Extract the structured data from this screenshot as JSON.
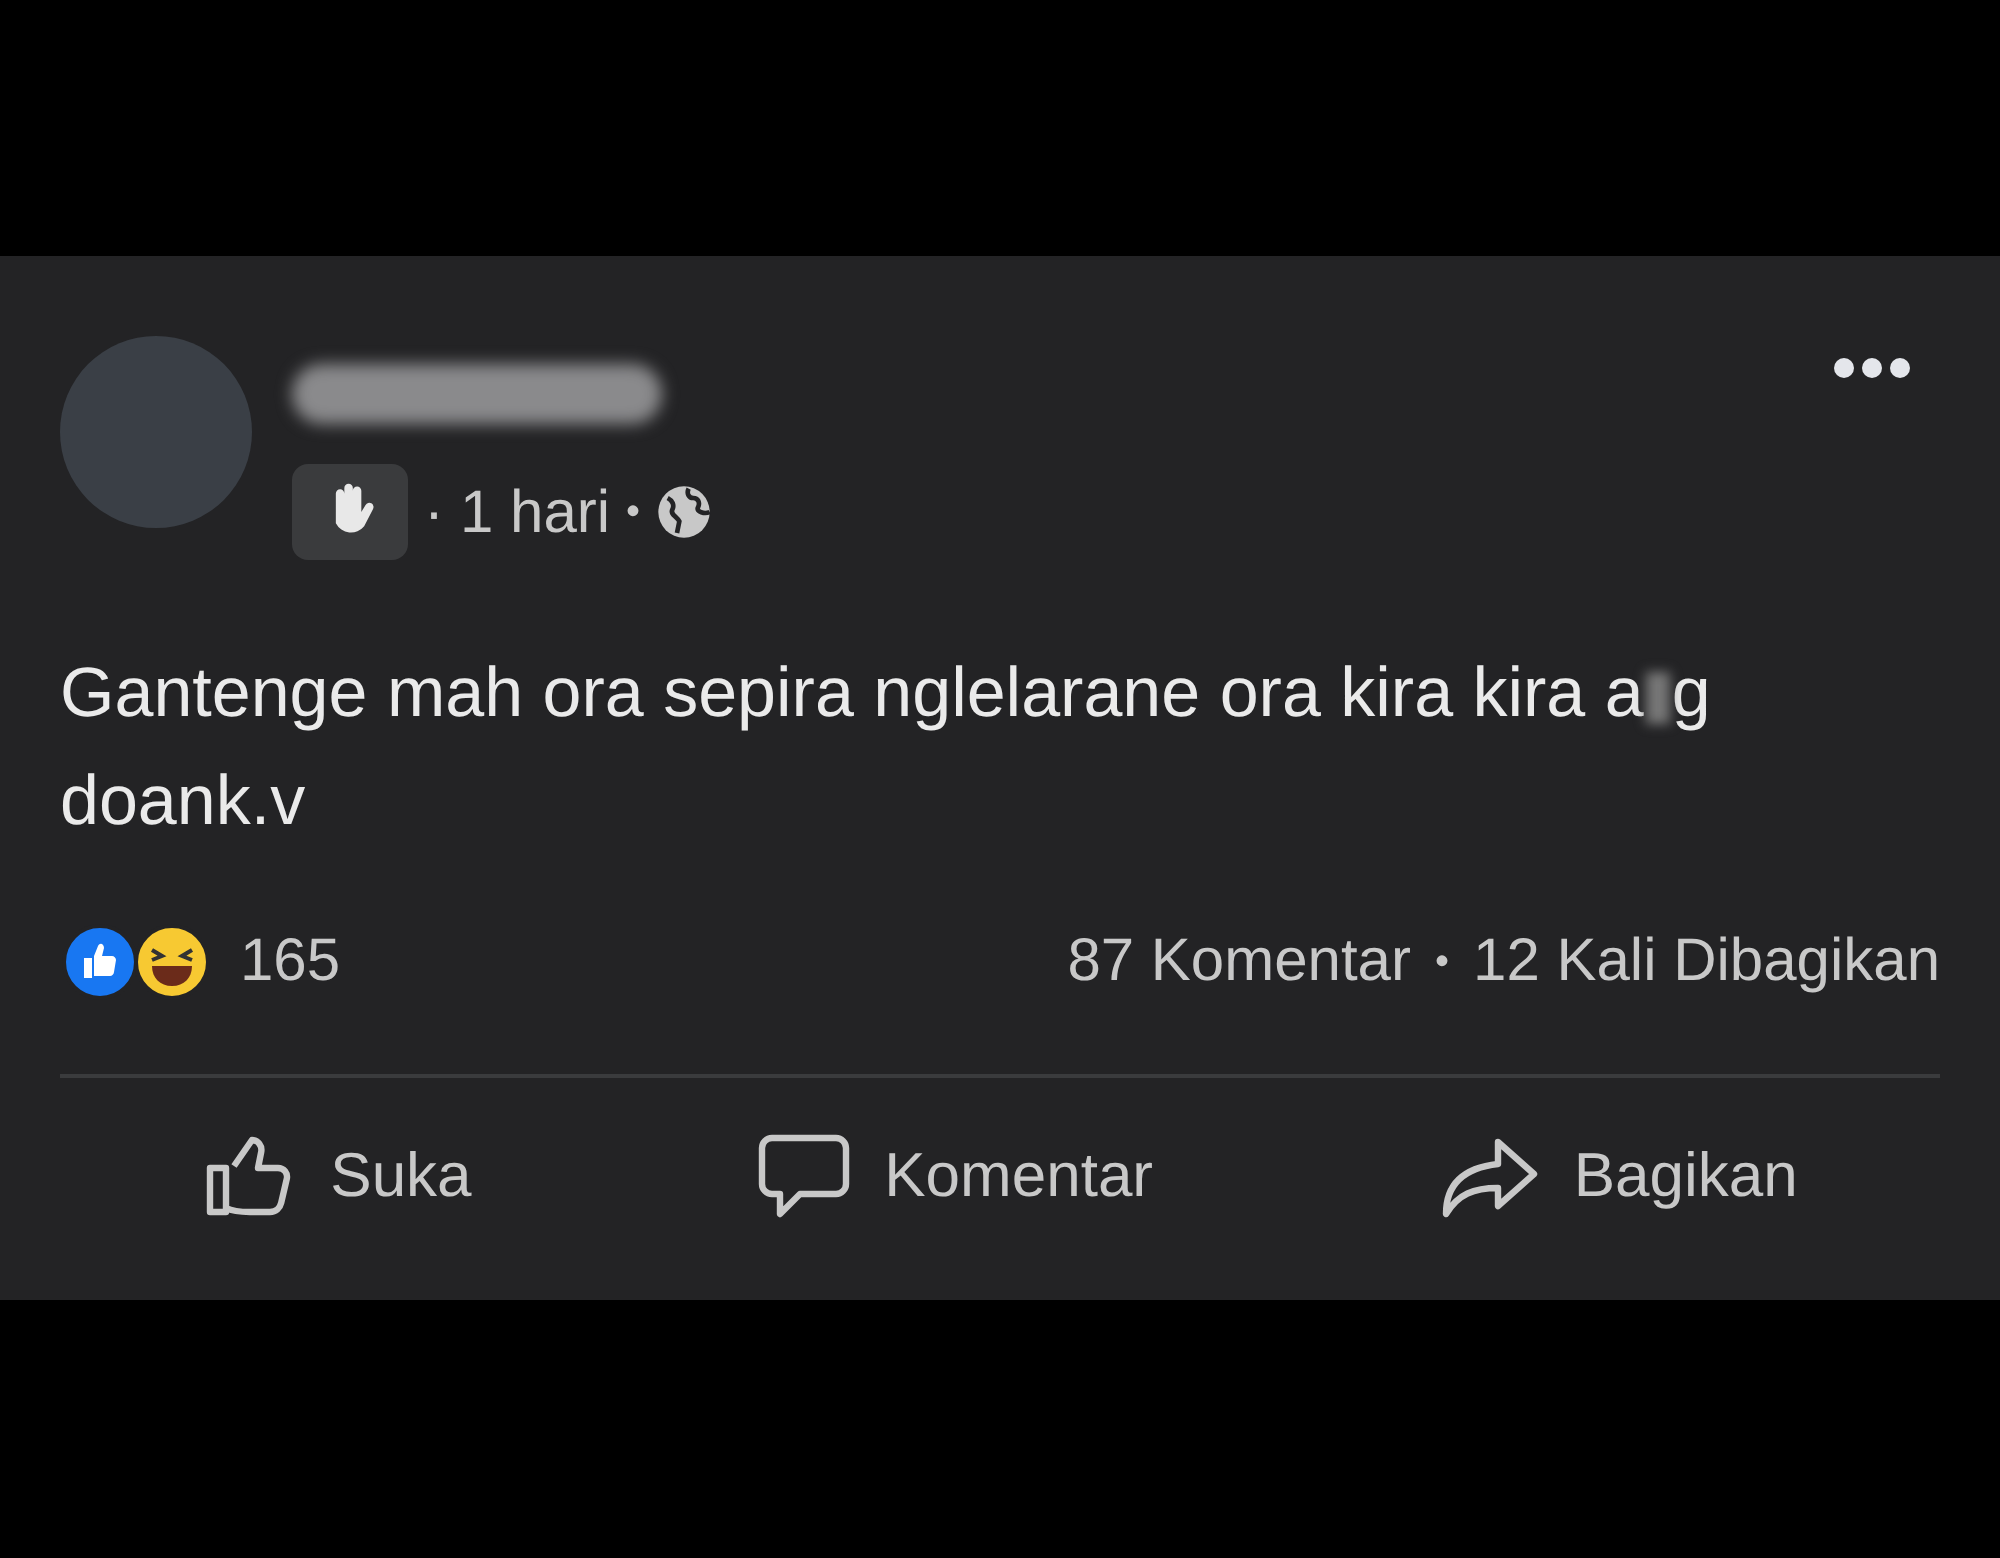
{
  "post": {
    "time_prefix": "·",
    "time": "1 hari",
    "time_suffix": "•",
    "body_start": "Gantenge mah ora sepira nglelarane ora kira kira a",
    "body_end": "g doank.v",
    "reaction_count": "165",
    "comments": "87 Komentar",
    "stats_separator": "•",
    "shares": "12 Kali Dibagikan",
    "actions": [
      {
        "label": "Suka",
        "kind": "like"
      },
      {
        "label": "Komentar",
        "kind": "comment"
      },
      {
        "label": "Bagikan",
        "kind": "share"
      }
    ]
  }
}
